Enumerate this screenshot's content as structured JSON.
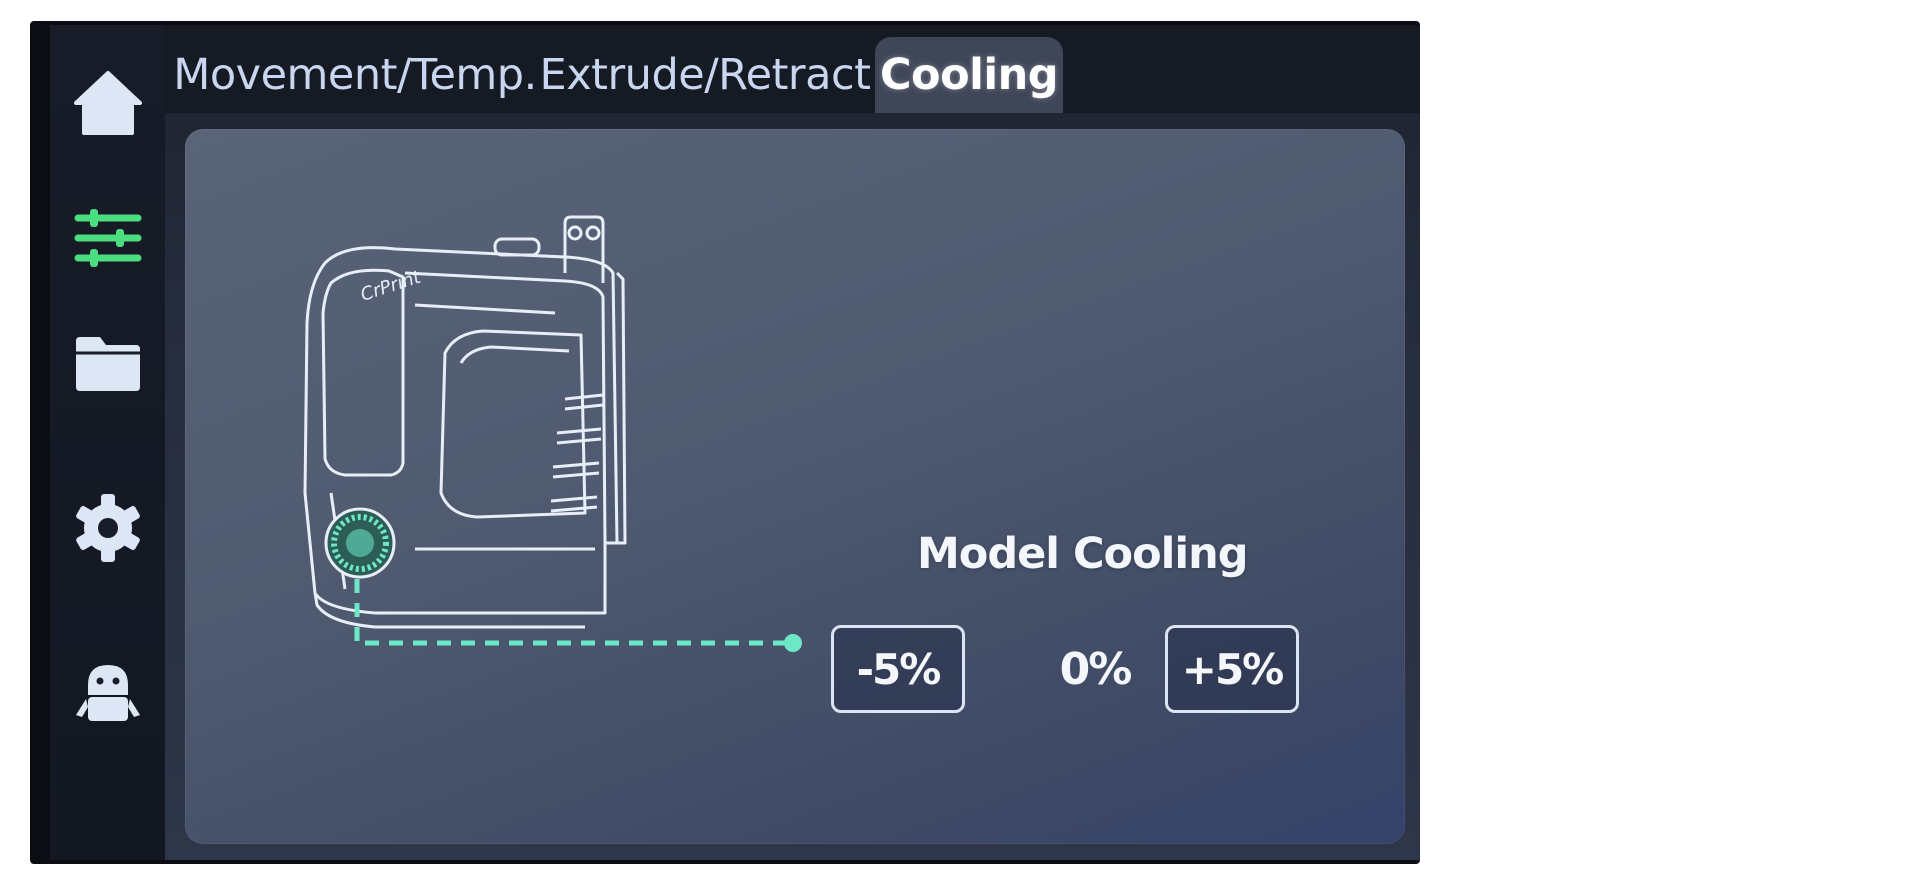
{
  "sidebar": {
    "items": [
      {
        "icon": "home-icon",
        "label": "Home"
      },
      {
        "icon": "sliders-icon",
        "label": "Control",
        "active": true
      },
      {
        "icon": "folder-icon",
        "label": "Files"
      },
      {
        "icon": "gear-icon",
        "label": "Settings"
      },
      {
        "icon": "robot-icon",
        "label": "Assistant"
      }
    ]
  },
  "tabs": [
    {
      "label": "Movement/Temp.",
      "active": false
    },
    {
      "label": "Extrude/Retract",
      "active": false
    },
    {
      "label": "Cooling",
      "active": true
    }
  ],
  "illustration": {
    "brand_text": "CrPrint"
  },
  "cooling": {
    "title": "Model Cooling",
    "decrease_label": "-5%",
    "value": "0%",
    "increase_label": "+5%"
  },
  "colors": {
    "accent": "#6ee7c7",
    "active_icon": "#4ade80",
    "icon": "#dce6f5",
    "outline": "#dbe4f4"
  }
}
